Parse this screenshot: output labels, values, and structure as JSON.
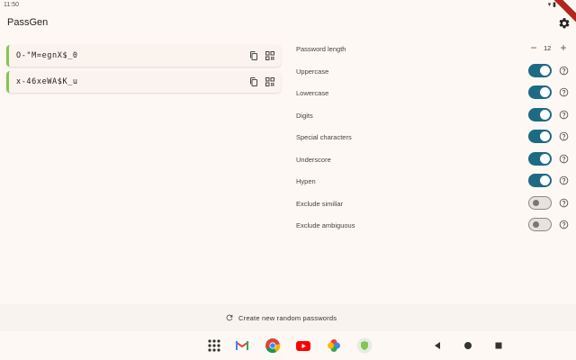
{
  "status": {
    "time": "11:50",
    "icons": "▾ ▮"
  },
  "app": {
    "title": "PassGen",
    "settings_icon": "gear-icon"
  },
  "passwords": [
    {
      "value": "O-\"M=egnX$_0"
    },
    {
      "value": "x-46xeWA$K_u"
    }
  ],
  "settings": {
    "length": {
      "label": "Password length",
      "value": "12",
      "minus": "−",
      "plus": "+"
    },
    "options": [
      {
        "label": "Uppercase",
        "enabled": true
      },
      {
        "label": "Lowercase",
        "enabled": true
      },
      {
        "label": "Digits",
        "enabled": true
      },
      {
        "label": "Special characters",
        "enabled": true
      },
      {
        "label": "Underscore",
        "enabled": true
      },
      {
        "label": "Hypen",
        "enabled": true
      },
      {
        "label": "Exclude similiar",
        "enabled": false
      },
      {
        "label": "Exclude ambiguous",
        "enabled": false
      }
    ]
  },
  "create_button": {
    "label": "Create new random passwords"
  },
  "colors": {
    "accent": "#1c6a84",
    "card_border": "#86c552",
    "background": "#fdf8f4"
  },
  "dock": [
    "apps-grid-icon",
    "gmail-icon",
    "chrome-icon",
    "youtube-icon",
    "photos-icon",
    "passgen-app-icon"
  ],
  "navigation": [
    "back-icon",
    "home-icon",
    "recents-icon"
  ]
}
